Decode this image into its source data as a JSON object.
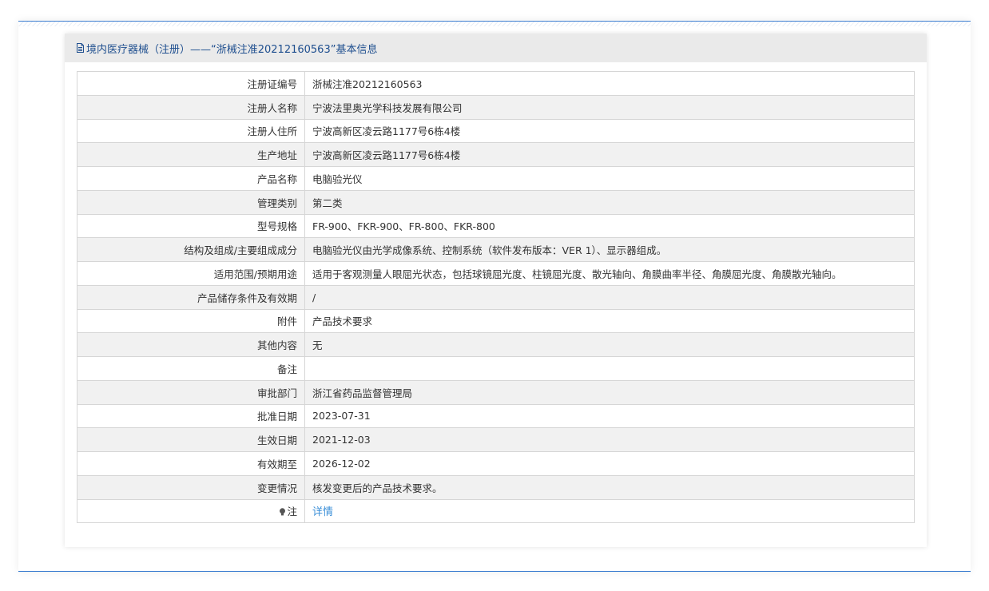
{
  "header": {
    "title": "境内医疗器械（注册）——“浙械注准20212160563”基本信息",
    "icon": "document-icon"
  },
  "rows": [
    {
      "label": "注册证编号",
      "value": "浙械注准20212160563"
    },
    {
      "label": "注册人名称",
      "value": "宁波法里奥光学科技发展有限公司"
    },
    {
      "label": "注册人住所",
      "value": "宁波高新区凌云路1177号6栋4楼"
    },
    {
      "label": "生产地址",
      "value": "宁波高新区凌云路1177号6栋4楼"
    },
    {
      "label": "产品名称",
      "value": "电脑验光仪"
    },
    {
      "label": "管理类别",
      "value": "第二类"
    },
    {
      "label": "型号规格",
      "value": "FR-900、FKR-900、FR-800、FKR-800"
    },
    {
      "label": "结构及组成/主要组成成分",
      "value": "电脑验光仪由光学成像系统、控制系统（软件发布版本：VER 1）、显示器组成。"
    },
    {
      "label": "适用范围/预期用途",
      "value": "适用于客观测量人眼屈光状态，包括球镜屈光度、柱镜屈光度、散光轴向、角膜曲率半径、角膜屈光度、角膜散光轴向。"
    },
    {
      "label": "产品储存条件及有效期",
      "value": "/"
    },
    {
      "label": "附件",
      "value": "产品技术要求"
    },
    {
      "label": "其他内容",
      "value": "无"
    },
    {
      "label": "备注",
      "value": ""
    },
    {
      "label": "审批部门",
      "value": "浙江省药品监督管理局"
    },
    {
      "label": "批准日期",
      "value": "2023-07-31"
    },
    {
      "label": "生效日期",
      "value": "2021-12-03"
    },
    {
      "label": "有效期至",
      "value": "2026-12-02"
    },
    {
      "label": "变更情况",
      "value": "核发变更后的产品技术要求。"
    }
  ],
  "note_row": {
    "label": "注",
    "icon": "lightbulb-icon",
    "link_text": "详情"
  },
  "colors": {
    "frame_line": "#3f7fd1",
    "header_text": "#1f4f8f",
    "header_bg": "#eaeaea",
    "stripe_bg": "#f1f1f1",
    "link": "#3b8fd8"
  }
}
